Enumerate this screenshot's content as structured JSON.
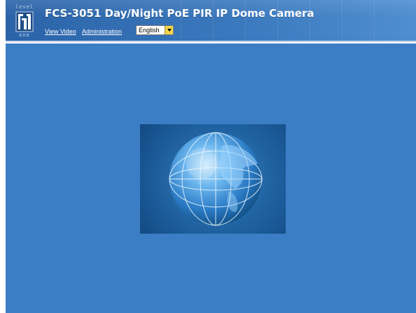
{
  "header": {
    "title": "FCS-3051 Day/Night PoE PIR IP Dome Camera",
    "logo": {
      "top_text": "level",
      "bottom_text": "one",
      "icon": "levelone-logo-icon"
    }
  },
  "nav": {
    "view_video": "View Video",
    "administration": "Administration"
  },
  "language": {
    "selected": "English"
  },
  "colors": {
    "header": "#3a78bd",
    "main_background": "#3b7ec5",
    "globe_panel": "#1b5a98"
  },
  "main": {
    "image": "globe-image"
  }
}
